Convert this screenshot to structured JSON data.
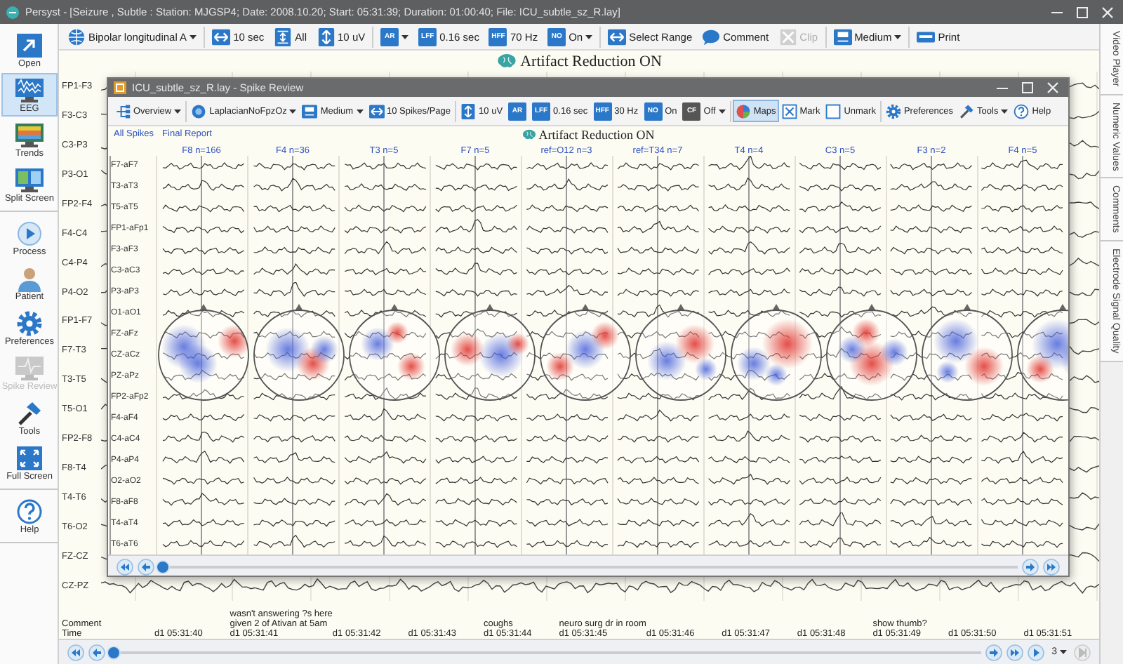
{
  "window": {
    "title": "Persyst - [Seizure , Subtle : Station: MJGSP4; Date: 2008.10.20; Start: 05:31:39; Duration: 01:00:40; File: ICU_subtle_sz_R.lay]"
  },
  "sidebar": {
    "groups": [
      {
        "items": [
          {
            "kind": "open",
            "label": "Open",
            "selected": false,
            "disabled": false
          },
          {
            "kind": "eeg",
            "label": "EEG",
            "selected": true,
            "disabled": false
          },
          {
            "kind": "trends",
            "label": "Trends",
            "selected": false,
            "disabled": false
          },
          {
            "kind": "split",
            "label": "Split Screen",
            "selected": false,
            "disabled": false
          }
        ]
      },
      {
        "items": [
          {
            "kind": "process",
            "label": "Process",
            "selected": false,
            "disabled": false
          },
          {
            "kind": "patient",
            "label": "Patient",
            "selected": false,
            "disabled": false
          },
          {
            "kind": "preferences",
            "label": "Preferences",
            "selected": false,
            "disabled": false
          },
          {
            "kind": "spike",
            "label": "Spike Review",
            "selected": false,
            "disabled": true
          },
          {
            "kind": "tools",
            "label": "Tools",
            "selected": false,
            "disabled": false
          },
          {
            "kind": "fullscreen",
            "label": "Full Screen",
            "selected": false,
            "disabled": false
          }
        ]
      },
      {
        "items": [
          {
            "kind": "help",
            "label": "Help",
            "selected": false,
            "disabled": false
          }
        ]
      }
    ]
  },
  "toolbar": {
    "items": [
      {
        "kind": "montage",
        "label": "Bipolar longitudinal A",
        "dropdown": true,
        "disabled": false
      },
      {
        "kind": "separator"
      },
      {
        "kind": "hspan",
        "label": "10 sec",
        "dropdown": false,
        "disabled": false
      },
      {
        "kind": "vfit",
        "label": "All",
        "dropdown": false,
        "disabled": false
      },
      {
        "kind": "vspan",
        "label": "10 uV",
        "dropdown": false,
        "disabled": false
      },
      {
        "kind": "separator"
      },
      {
        "kind": "filter",
        "badge": "AR",
        "dropdown": true,
        "disabled": false
      },
      {
        "kind": "filter",
        "badge": "LFF",
        "label": "0.16 sec",
        "dropdown": false,
        "disabled": false
      },
      {
        "kind": "filter",
        "badge": "HFF",
        "label": "70 Hz",
        "dropdown": false,
        "disabled": false
      },
      {
        "kind": "filter",
        "badge": "NO",
        "label": "On",
        "dropdown": true,
        "disabled": false
      },
      {
        "kind": "separator"
      },
      {
        "kind": "hspan",
        "label": "Select Range",
        "dropdown": false,
        "disabled": false
      },
      {
        "kind": "comment",
        "label": "Comment",
        "dropdown": false,
        "disabled": false
      },
      {
        "kind": "clip",
        "label": "Clip",
        "dropdown": false,
        "disabled": true
      },
      {
        "kind": "separator"
      },
      {
        "kind": "medium",
        "label": "Medium",
        "dropdown": true,
        "disabled": false
      },
      {
        "kind": "separator"
      },
      {
        "kind": "print",
        "label": "Print",
        "dropdown": false,
        "disabled": false
      }
    ]
  },
  "banner": "Artifact Reduction ON",
  "channels": [
    "FP1-F3",
    "F3-C3",
    "C3-P3",
    "P3-O1",
    "FP2-F4",
    "F4-C4",
    "C4-P4",
    "P4-O2",
    "FP1-F7",
    "F7-T3",
    "T3-T5",
    "T5-O1",
    "FP2-F8",
    "F8-T4",
    "T4-T6",
    "T6-O2",
    "FZ-CZ",
    "CZ-PZ"
  ],
  "annotations": {
    "comment_label": "Comment",
    "time_label": "Time",
    "seconds": [
      {
        "time": "d1 05:31:40"
      },
      {
        "time": "d1 05:31:41",
        "comments": [
          "wasn't answering ?s here",
          "given 2 of Ativan at 5am"
        ]
      },
      {
        "time": "d1 05:31:42"
      },
      {
        "time": "d1 05:31:43"
      },
      {
        "time": "d1 05:31:44",
        "comments": [
          "coughs"
        ]
      },
      {
        "time": "d1 05:31:45",
        "comments": [
          "neuro surg dr in room"
        ]
      },
      {
        "time": "d1 05:31:46"
      },
      {
        "time": "d1 05:31:47"
      },
      {
        "time": "d1 05:31:48"
      },
      {
        "time": "d1 05:31:49",
        "comments": [
          "show thumb?"
        ]
      },
      {
        "time": "d1 05:31:50"
      },
      {
        "time": "d1 05:31:51"
      }
    ]
  },
  "spike_window": {
    "title": "ICU_subtle_sz_R.lay - Spike Review",
    "toolbar": {
      "items": [
        {
          "kind": "overview",
          "label": "Overview",
          "dropdown": true,
          "pressed": false
        },
        {
          "kind": "separator"
        },
        {
          "kind": "laplacian",
          "label": "LaplacianNoFpzOz",
          "dropdown": true,
          "pressed": false
        },
        {
          "kind": "medium",
          "label": "Medium",
          "dropdown": true,
          "pressed": false
        },
        {
          "kind": "hspan",
          "label": "10 Spikes/Page",
          "dropdown": false,
          "pressed": false
        },
        {
          "kind": "separator"
        },
        {
          "kind": "vspan",
          "label": "10 uV",
          "dropdown": false,
          "pressed": false
        },
        {
          "kind": "filter",
          "badge": "AR",
          "dropdown": false,
          "pressed": false
        },
        {
          "kind": "filter",
          "badge": "LFF",
          "label": "0.16 sec",
          "dropdown": false,
          "pressed": false
        },
        {
          "kind": "filter",
          "badge": "HFF",
          "label": "30 Hz",
          "dropdown": false,
          "pressed": false
        },
        {
          "kind": "filter",
          "badge": "NO",
          "label": "On",
          "dropdown": false,
          "pressed": false
        },
        {
          "kind": "filter_dark",
          "badge": "CF",
          "label": "Off",
          "dropdown": true,
          "pressed": false
        },
        {
          "kind": "separator"
        },
        {
          "kind": "maps",
          "label": "Maps",
          "dropdown": false,
          "pressed": true
        },
        {
          "kind": "mark",
          "label": "Mark",
          "dropdown": false,
          "pressed": false
        },
        {
          "kind": "unmark",
          "label": "Unmark",
          "dropdown": false,
          "pressed": false
        },
        {
          "kind": "separator"
        },
        {
          "kind": "gear",
          "label": "Preferences",
          "dropdown": false,
          "pressed": false
        },
        {
          "kind": "tools",
          "label": "Tools",
          "dropdown": true,
          "pressed": false
        },
        {
          "kind": "help",
          "label": "Help",
          "dropdown": false,
          "pressed": false
        }
      ]
    },
    "links": [
      "All Spikes",
      "Final Report"
    ],
    "banner": "Artifact Reduction ON",
    "spikes": [
      "F8 n=166",
      "F4 n=36",
      "T3 n=5",
      "F7 n=5",
      "ref=O12 n=3",
      "ref=T34 n=7",
      "T4 n=4",
      "C3 n=5",
      "F3 n=2",
      "F4 n=5"
    ],
    "channels": [
      "F7-aF7",
      "T3-aT3",
      "T5-aT5",
      "FP1-aFp1",
      "F3-aF3",
      "C3-aC3",
      "P3-aP3",
      "O1-aO1",
      "FZ-aFz",
      "CZ-aCz",
      "PZ-aPz",
      "FP2-aFp2",
      "F4-aF4",
      "C4-aC4",
      "P4-aP4",
      "O2-aO2",
      "F8-aF8",
      "T4-aT4",
      "T6-aT6"
    ]
  },
  "side_tabs": [
    "Video Player",
    "Numeric Values",
    "Comments",
    "Electrode Signal Quality"
  ],
  "playback": {
    "speed": "3"
  }
}
